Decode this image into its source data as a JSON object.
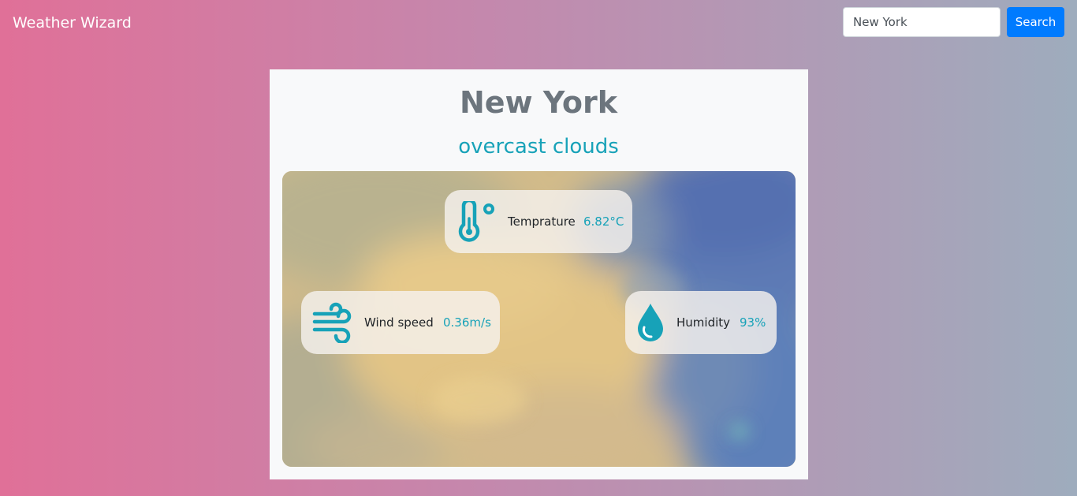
{
  "navbar": {
    "brand": "Weather Wizard",
    "search": {
      "value": "New York",
      "button_label": "Search"
    }
  },
  "weather": {
    "city": "New York",
    "description": "overcast clouds",
    "temperature": {
      "label": "Temprature",
      "value": "6.82°C",
      "icon": "thermometer-icon"
    },
    "wind": {
      "label": "Wind speed",
      "value": "0.36m/s",
      "icon": "wind-icon"
    },
    "humidity": {
      "label": "Humidity",
      "value": "93%",
      "icon": "water-drop-icon"
    }
  },
  "colors": {
    "accent": "#17a2b8",
    "primary_button": "#007bff",
    "title": "#6c757d",
    "gradient_start": "#e07098",
    "gradient_end": "#9eacbd"
  }
}
